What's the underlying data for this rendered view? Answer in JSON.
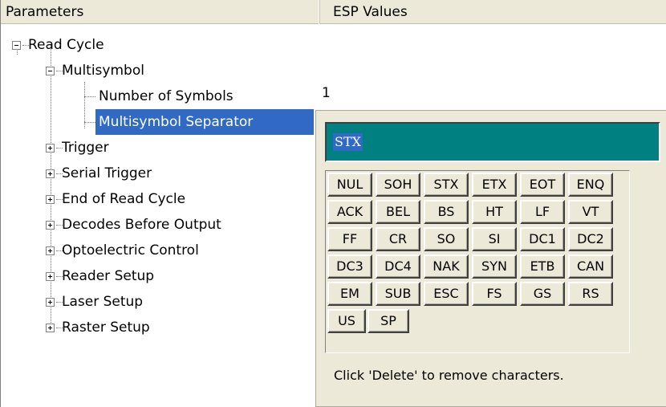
{
  "header": {
    "parameters_label": "Parameters",
    "esp_values_label": "ESP Values"
  },
  "tree": {
    "root": "Read Cycle",
    "multisymbol": "Multisymbol",
    "number_of_symbols": "Number of Symbols",
    "multisymbol_separator": "Multisymbol Separator",
    "items": [
      "Trigger",
      "Serial Trigger",
      "End of Read Cycle",
      "Decodes Before Output",
      "Optoelectric Control",
      "Reader Setup",
      "Laser Setup",
      "Raster Setup"
    ]
  },
  "values": {
    "number_of_symbols": "1"
  },
  "popup": {
    "input_value": "STX",
    "buttons": [
      [
        "NUL",
        "SOH",
        "STX",
        "ETX",
        "EOT",
        "ENQ"
      ],
      [
        "ACK",
        "BEL",
        "BS",
        "HT",
        "LF",
        "VT"
      ],
      [
        "FF",
        "CR",
        "SO",
        "SI",
        "DC1",
        "DC2"
      ],
      [
        "DC3",
        "DC4",
        "NAK",
        "SYN",
        "ETB",
        "CAN"
      ],
      [
        "EM",
        "SUB",
        "ESC",
        "FS",
        "GS",
        "RS"
      ],
      [
        "US",
        "SP"
      ]
    ],
    "hint": "Click 'Delete' to remove characters."
  }
}
